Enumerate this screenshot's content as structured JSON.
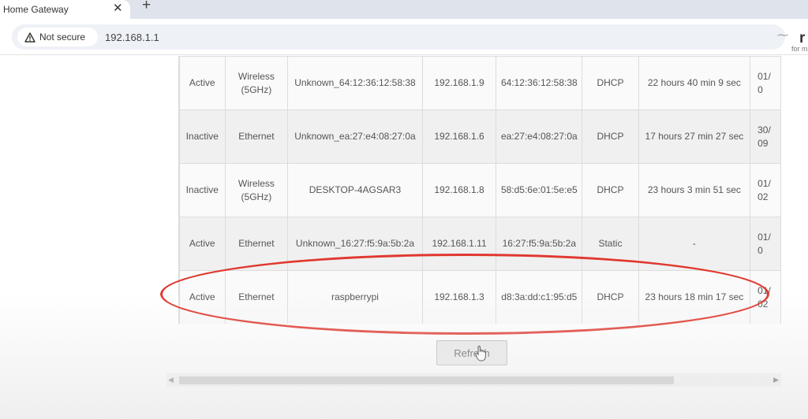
{
  "browser": {
    "tab_title": "Home Gateway",
    "tab_close": "✕",
    "new_tab": "+",
    "security_label": "Not secure",
    "url": "192.168.1.1"
  },
  "logo": {
    "letter": "r",
    "tagline": "for m"
  },
  "devices": [
    {
      "status": "Active",
      "connection": [
        "Wireless",
        "(5GHz)"
      ],
      "name": "Unknown_64:12:36:12:58:38",
      "ip": "192.168.1.9",
      "mac": "64:12:36:12:58:38",
      "type": "DHCP",
      "lease": "22 hours 40 min 9 sec",
      "expires": [
        "01/",
        "0"
      ]
    },
    {
      "status": "Inactive",
      "connection": [
        "Ethernet"
      ],
      "name": "Unknown_ea:27:e4:08:27:0a",
      "ip": "192.168.1.6",
      "mac": "ea:27:e4:08:27:0a",
      "type": "DHCP",
      "lease": "17 hours 27 min 27 sec",
      "expires": [
        "30/",
        "09"
      ]
    },
    {
      "status": "Inactive",
      "connection": [
        "Wireless",
        "(5GHz)"
      ],
      "name": "DESKTOP-4AGSAR3",
      "ip": "192.168.1.8",
      "mac": "58:d5:6e:01:5e:e5",
      "type": "DHCP",
      "lease": "23 hours 3 min 51 sec",
      "expires": [
        "01/",
        "02"
      ]
    },
    {
      "status": "Active",
      "connection": [
        "Ethernet"
      ],
      "name": "Unknown_16:27:f5:9a:5b:2a",
      "ip": "192.168.1.11",
      "mac": "16:27:f5:9a:5b:2a",
      "type": "Static",
      "lease": "-",
      "expires": [
        "01/",
        "0"
      ]
    },
    {
      "status": "Active",
      "connection": [
        "Ethernet"
      ],
      "name": "raspberrypi",
      "ip": "192.168.1.3",
      "mac": "d8:3a:dd:c1:95:d5",
      "type": "DHCP",
      "lease": "23 hours 18 min 17 sec",
      "expires": [
        "01/",
        "02"
      ]
    }
  ],
  "refresh_label": "Refresh",
  "scrollbar": {
    "left_arrow": "◀",
    "right_arrow": "▶",
    "position_fraction": 0.0,
    "visible_fraction": 0.84
  },
  "colors": {
    "highlight": "#e0382f",
    "warning_icon": "#333333"
  }
}
